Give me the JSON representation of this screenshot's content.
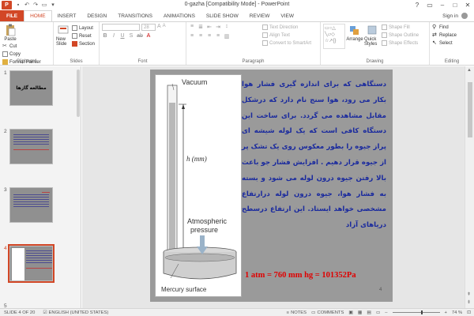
{
  "window": {
    "app_logo": "P",
    "title": "0-gazha [Compatibility Mode] - PowerPoint",
    "controls": [
      "?",
      "▭",
      "–",
      "□",
      "✕"
    ]
  },
  "tabs": [
    "FILE",
    "HOME",
    "INSERT",
    "DESIGN",
    "TRANSITIONS",
    "ANIMATIONS",
    "SLIDE SHOW",
    "REVIEW",
    "VIEW"
  ],
  "signin": "Sign in",
  "ribbon": {
    "clipboard": {
      "label": "Clipboard",
      "paste": "Paste",
      "cut": "Cut",
      "copy": "Copy",
      "format_painter": "Format Painter"
    },
    "slides": {
      "label": "Slides",
      "new_slide": "New Slide",
      "layout": "Layout",
      "reset": "Reset",
      "section": "Section"
    },
    "font": {
      "label": "Font",
      "size": "28"
    },
    "paragraph": {
      "label": "Paragraph",
      "text_direction": "Text Direction",
      "align_text": "Align Text",
      "convert_smartart": "Convert to SmartArt"
    },
    "drawing": {
      "label": "Drawing",
      "arrange": "Arrange",
      "quick_styles": "Quick Styles",
      "shape_fill": "Shape Fill",
      "shape_outline": "Shape Outline",
      "shape_effects": "Shape Effects"
    },
    "editing": {
      "label": "Editing",
      "find": "Find",
      "replace": "Replace",
      "select": "Select"
    }
  },
  "thumbnails": [
    {
      "num": "1",
      "title": "مطالعه گازها"
    },
    {
      "num": "2"
    },
    {
      "num": "3"
    },
    {
      "num": "4"
    },
    {
      "num": "5"
    }
  ],
  "slide": {
    "figure": {
      "vacuum": "Vacuum",
      "h_label": "h (mm)",
      "atm": "Atmospheric",
      "pressure": "pressure",
      "mercury": "Mercury surface"
    },
    "body_text": "دستگاهی که برای اندازه گیری فشار هوا بکار می رود، هوا سنج نام دارد که درشکل مقابل مشاهده می گردد. برای ساخت این دستگاه کافی است که یک لوله شیشه ای پراز جیوه را بطور معکوس روی یک تشک پر از جیوه قرار دهیم . افزایش فشار جو باعث بالا رفتن جیوه درون لوله می شود و بسته به فشار هوا، جیوه درون لوله درارتفاع مشخصی خواهد ایستاد. این ارتفاع درسطح دریاهای آزاد",
    "equation": "1 atm = 760 mm hg = 101352Pa",
    "number": "4"
  },
  "status": {
    "slide_of": "SLIDE 4 OF 20",
    "language": "ENGLISH (UNITED STATES)",
    "notes": "NOTES",
    "comments": "COMMENTS",
    "zoom": "74 %"
  },
  "colors": {
    "accent": "#d24726",
    "slide_text": "#1a2a9e",
    "equation": "#e00000"
  }
}
